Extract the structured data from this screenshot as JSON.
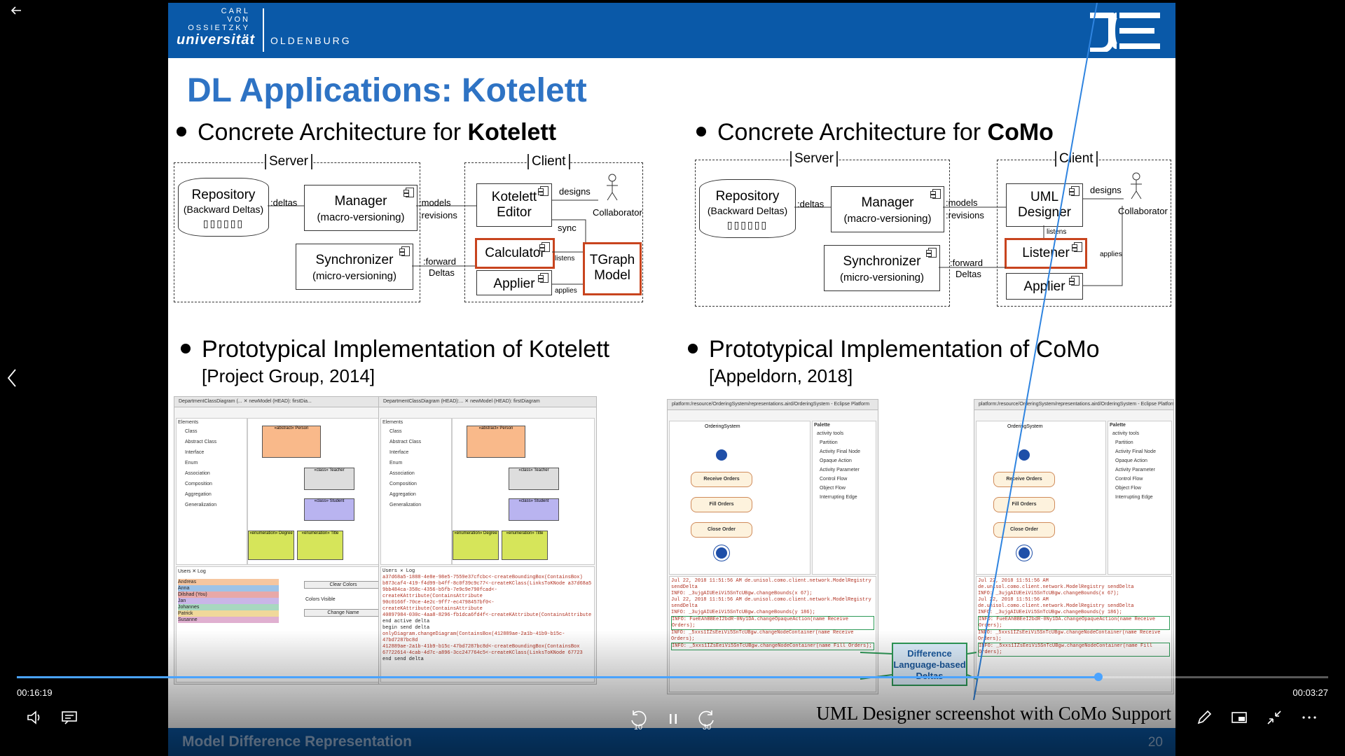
{
  "slide": {
    "logo": {
      "carl": "CARL",
      "von": "VON",
      "ossietzky": "OSSIETZKY",
      "universitat": "universität",
      "oldenburg": "OLDENBURG"
    },
    "title": "DL Applications: Kotelett",
    "left": {
      "arch_prefix": "Concrete Architecture for ",
      "arch_bold": "Kotelett",
      "server_label": "Server",
      "client_label": "Client",
      "repository": "Repository",
      "repository_sub": "(Backward Deltas)",
      "manager": "Manager",
      "manager_sub": "(macro-versioning)",
      "synchronizer": "Synchronizer",
      "synchronizer_sub": "(micro-versioning)",
      "editor": "Kotelett Editor",
      "calculator": "Calculator",
      "applier": "Applier",
      "tgraph": "TGraph Model",
      "collaborator": "Collaborator",
      "e_deltas": ":deltas",
      "e_models": ":models",
      "e_revisions": ":revisions",
      "e_designs": "designs",
      "e_sync": "sync",
      "e_listens": "listens",
      "e_applies": "applies",
      "e_forward": ":forward",
      "e_forward2": "Deltas",
      "proto": "Prototypical Implementation of Kotelett",
      "cite": "[Project Group, 2014]"
    },
    "right": {
      "arch_prefix": "Concrete Architecture for ",
      "arch_bold": "CoMo",
      "server_label": "Server",
      "client_label": "Client",
      "repository": "Repository",
      "repository_sub": "(Backward Deltas)",
      "manager": "Manager",
      "manager_sub": "(macro-versioning)",
      "synchronizer": "Synchronizer",
      "synchronizer_sub": "(micro-versioning)",
      "designer": "UML Designer",
      "listener": "Listener",
      "applier": "Applier",
      "collaborator": "Collaborator",
      "e_deltas": ":deltas",
      "e_models": ":models",
      "e_revisions": ":revisions",
      "e_designs": "designs",
      "e_listens": "listens",
      "e_applies": "applies",
      "e_forward": ":forward",
      "e_forward2": "Deltas",
      "proto": "Prototypical Implementation of CoMo",
      "cite": "[Appeldorn, 2018]",
      "diff_box": "Difference Language-based Deltas"
    },
    "shots": {
      "left_tab1": "DepartmentClassDiagram (...  ✕  newModel (HEAD): firstDia...",
      "left_tab2": "DepartmentClassDiagram (HEAD):...  ✕  newModel (HEAD): firstDiagram",
      "palette": [
        "Elements",
        "Class",
        "Abstract Class",
        "Interface",
        "Enum",
        "Association",
        "Composition",
        "Aggregation",
        "Generalization"
      ],
      "person": "«abstract» Person",
      "teacher": "«class» Teacher",
      "student": "«class» Student",
      "degree": "«enumeration» Degree",
      "title_enum": "«enumeration» Title",
      "right_title": "platform:/resource/OrderingSystem/representations.aird/OrderingSystem - Eclipse Platform",
      "ordering": "OrderingSystem",
      "receive": "Receive Orders",
      "fill": "Fill Orders",
      "close": "Close Order",
      "palette_title": "Palette",
      "palette_items": [
        "activity tools",
        "Partition",
        "Activity Final Node",
        "Opaque Action",
        "Activity Parameter",
        "Control Flow",
        "Object Flow",
        "Interrupting Edge"
      ],
      "users_tab": "Users  ✕  Log",
      "clear_colors": "Clear Colors",
      "colors_visible": "Colors Visible",
      "change_name": "Change Name",
      "users": [
        "Andreas",
        "Anna",
        "Dilshad (You)",
        "Jan",
        "Johannes",
        "Patrick",
        "Susanne"
      ],
      "log_lines": [
        "Jul 22, 2018 11:51:56 AM de.unisol.como.client.network.ModelRegistry sendDelta",
        "INFO: _3ujgAIUEeiVi5SnTcUBgw.changeBounds(x 67);",
        "Jul 22, 2018 11:51:56 AM de.unisol.como.client.network.ModelRegistry sendDelta",
        "INFO: _3ujgAIUEeiVi5SnTcUBgw.changeBounds(y 186);",
        "INFO: FueEAhBBEeI2bdR-0Ny1DA.changeOpaqueAction(name Receive Orders);",
        "INFO: _5xxs1IZsEeiVi5SnTcUBgw.changeNodeContainer(name Receive Orders);",
        "INFO: _5xxs1IZsEeiVi5SnTcUBgw.changeNodeContainer(name Fill Orders);"
      ],
      "delta_lines": [
        "a37d68a5-1888-4e8e-98e5-7559e37cfcbc<-createBoundingBox(ContainsBox)",
        "b873caf4-419-f4d99-b4ff-8c0f39c9c77<-createKClass(LinksToKNode a37d68a5",
        "9bb484ca-358c-4356-b5fb-7e9c9e790fcad<-createKAttribute(ContainsAttribute",
        "90c0166f-70ce-4e2c-9ff7-ec4798457bf0<-createKAttribute(ContainsAttribute",
        "40897984-030c-4aa8-8296-fb1dca6fd4f<-createKAttribute(ContainsAttribute",
        "end active delta",
        "begin send delta",
        "onlyDiagram.changeDiagram(ContainsBox(412889ae-2a1b-41b9-b15c-47bd7287bc8d",
        "412889ae-2a1b-41b9-b15c-47bd7287bc8d<-createBoundingBox(ContainsBox",
        "67722614-4cab-4d7c-a896-3cc247764c5<-createKClass(LinksToKNode 67723",
        "end send delta"
      ]
    },
    "caption": "UML Designer screenshot with CoMo Support",
    "footer_title": "Model Difference Representation",
    "page": "20"
  },
  "player": {
    "current_time": "00:16:19",
    "remaining_time": "00:03:27",
    "progress_fraction": 0.825,
    "rewind_label": "10",
    "forward_label": "30",
    "icons": {
      "back": "back-arrow-icon",
      "prev": "chevron-left-icon",
      "volume": "volume-icon",
      "captions": "captions-icon",
      "rewind": "rewind-10-icon",
      "pause": "pause-icon",
      "forward": "forward-30-icon",
      "pen": "pen-icon",
      "miniplayer": "miniplayer-icon",
      "fullscreen": "exit-fullscreen-icon",
      "more": "more-icon"
    },
    "colors": {
      "accent": "#4aa3ff",
      "slide_blue": "#0a59a8",
      "title_blue": "#2e73c4",
      "highlight_red": "#c8441e"
    }
  }
}
